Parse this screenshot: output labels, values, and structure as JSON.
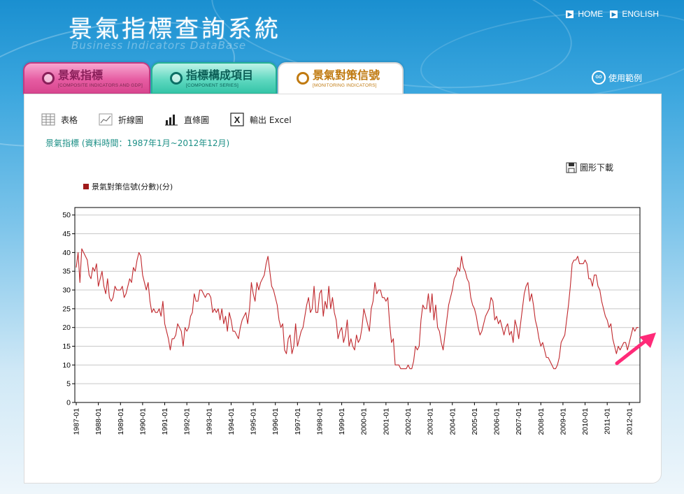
{
  "header": {
    "title": "景氣指標查詢系統",
    "subtitle": "Business Indicators DataBase"
  },
  "topnav": [
    {
      "label": "HOME"
    },
    {
      "label": "ENGLISH"
    }
  ],
  "tabs": [
    {
      "label": "景氣指標",
      "en": "[COMPOSITE INDICATORS AND GDP]",
      "active": false
    },
    {
      "label": "指標構成項目",
      "en": "[COMPONENT SERIES]",
      "active": false
    },
    {
      "label": "景氣對策信號",
      "en": "[MONITORING INDICATORS]",
      "active": true
    }
  ],
  "help": {
    "go": "GO",
    "label": "使用範例"
  },
  "toolbar": {
    "table": "表格",
    "line": "折線圖",
    "bar": "直條圖",
    "excel": "輸出 Excel"
  },
  "period_text": "景氣指標 (資料時間：1987年1月~2012年12月)",
  "download_label": "圖形下載",
  "colors": {
    "series": "#c0282d",
    "accent_teal": "#1c8f86"
  },
  "chart_data": {
    "type": "line",
    "title": "",
    "xlabel": "",
    "ylabel": "",
    "ylim": [
      0,
      52
    ],
    "yticks": [
      0,
      5,
      10,
      15,
      20,
      25,
      30,
      35,
      40,
      45,
      50
    ],
    "xticks": [
      "1987-01",
      "1988-01",
      "1989-01",
      "1990-01",
      "1991-01",
      "1992-01",
      "1993-01",
      "1994-01",
      "1995-01",
      "1996-01",
      "1997-01",
      "1998-01",
      "1999-01",
      "2000-01",
      "2001-01",
      "2002-01",
      "2003-01",
      "2004-01",
      "2005-01",
      "2006-01",
      "2007-01",
      "2008-01",
      "2009-01",
      "2010-01",
      "2011-01",
      "2012-01"
    ],
    "grid": "horizontal",
    "legend_position": "top-left",
    "series": [
      {
        "name": "景氣對策信號(分數)(分)",
        "start": "1987-01",
        "frequency": "monthly",
        "values": [
          36,
          40,
          32,
          41,
          40,
          39,
          38,
          34,
          33,
          36,
          35,
          37,
          31,
          33,
          35,
          31,
          29,
          33,
          28,
          27,
          28,
          31,
          30,
          30,
          30,
          31,
          28,
          29,
          31,
          33,
          32,
          36,
          35,
          38,
          40,
          39,
          34,
          32,
          30,
          32,
          27,
          24,
          25,
          24,
          24,
          25,
          23,
          27,
          21,
          19,
          17,
          14,
          17,
          17,
          18,
          21,
          20,
          19,
          15,
          20,
          19,
          20,
          23,
          24,
          29,
          27,
          27,
          30,
          30,
          29,
          28,
          29,
          29,
          28,
          24,
          25,
          24,
          25,
          22,
          25,
          21,
          23,
          19,
          24,
          22,
          19,
          19,
          18,
          17,
          20,
          22,
          23,
          24,
          21,
          25,
          32,
          29,
          27,
          32,
          30,
          32,
          33,
          34,
          37,
          39,
          35,
          31,
          30,
          28,
          26,
          22,
          20,
          21,
          14,
          13,
          17,
          18,
          13,
          15,
          21,
          15,
          17,
          19,
          20,
          23,
          26,
          28,
          24,
          25,
          31,
          24,
          24,
          29,
          30,
          23,
          27,
          25,
          31,
          25,
          28,
          24,
          22,
          17,
          19,
          20,
          16,
          18,
          22,
          15,
          17,
          15,
          14,
          18,
          16,
          17,
          20,
          25,
          23,
          21,
          19,
          25,
          27,
          32,
          29,
          30,
          30,
          28,
          28,
          27,
          28,
          21,
          16,
          17,
          10,
          10,
          10,
          9,
          9,
          9,
          9,
          10,
          9,
          9,
          11,
          15,
          14,
          15,
          22,
          26,
          25,
          25,
          29,
          24,
          29,
          22,
          26,
          20,
          19,
          16,
          14,
          18,
          22,
          26,
          28,
          30,
          33,
          34,
          36,
          35,
          39,
          36,
          35,
          33,
          32,
          28,
          26,
          25,
          23,
          20,
          18,
          19,
          21,
          23,
          24,
          25,
          28,
          27,
          22,
          23,
          21,
          22,
          20,
          18,
          20,
          21,
          18,
          19,
          16,
          22,
          20,
          17,
          21,
          25,
          29,
          31,
          32,
          27,
          29,
          26,
          22,
          20,
          17,
          15,
          16,
          14,
          12,
          12,
          11,
          10,
          9,
          9,
          10,
          12,
          16,
          17,
          18,
          22,
          26,
          31,
          37,
          38,
          38,
          39,
          37,
          37,
          37,
          38,
          37,
          33,
          33,
          31,
          34,
          34,
          31,
          30,
          27,
          25,
          23,
          22,
          20,
          21,
          17,
          15,
          13,
          15,
          14,
          15,
          16,
          16,
          14,
          16,
          18,
          20,
          19,
          20,
          20
        ]
      }
    ]
  }
}
